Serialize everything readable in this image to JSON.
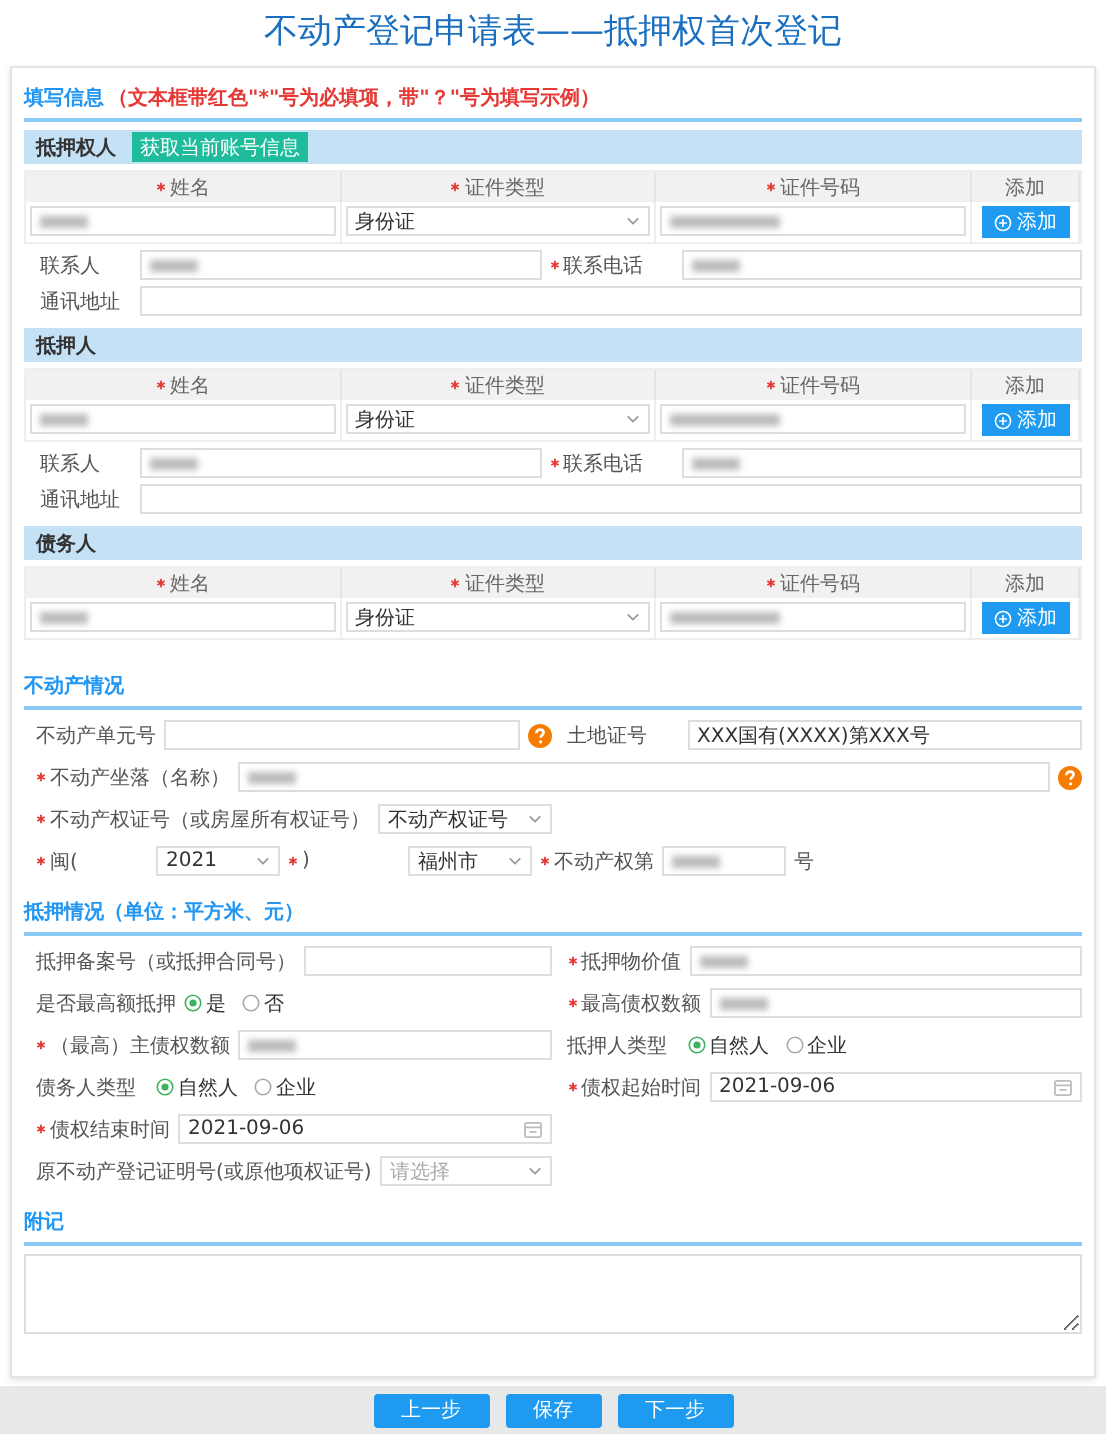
{
  "title": "不动产登记申请表——抵押权首次登记",
  "intro": {
    "title": "填写信息",
    "note": "（文本框带红色\"*\"号为必填项，带\"？\"号为填写示例）"
  },
  "parties": [
    {
      "title": "抵押权人",
      "action_button": "获取当前账号信息",
      "columns": [
        {
          "label": "姓名",
          "required": true
        },
        {
          "label": "证件类型",
          "required": true
        },
        {
          "label": "证件号码",
          "required": true
        },
        {
          "label": "添加",
          "required": false
        }
      ],
      "entry": {
        "name_blurred": true,
        "id_type": "身份证",
        "id_number_blurred": true,
        "add_button": "添加"
      },
      "contact": {
        "label": "联系人",
        "blurred": true
      },
      "phone": {
        "label": "联系电话",
        "required": true,
        "blurred": true
      },
      "address": {
        "label": "通讯地址"
      }
    },
    {
      "title": "抵押人",
      "columns": [
        {
          "label": "姓名",
          "required": true
        },
        {
          "label": "证件类型",
          "required": true
        },
        {
          "label": "证件号码",
          "required": true
        },
        {
          "label": "添加",
          "required": false
        }
      ],
      "entry": {
        "name_blurred": true,
        "id_type": "身份证",
        "id_number_blurred": true,
        "add_button": "添加"
      },
      "contact": {
        "label": "联系人",
        "blurred": true
      },
      "phone": {
        "label": "联系电话",
        "required": true,
        "blurred": true
      },
      "address": {
        "label": "通讯地址"
      }
    },
    {
      "title": "债务人",
      "columns": [
        {
          "label": "姓名",
          "required": true
        },
        {
          "label": "证件类型",
          "required": true
        },
        {
          "label": "证件号码",
          "required": true
        },
        {
          "label": "添加",
          "required": false
        }
      ],
      "entry": {
        "name_blurred": true,
        "id_type": "身份证",
        "id_number_blurred": true,
        "add_button": "添加"
      }
    }
  ],
  "sections": [
    {
      "title": "不动产情况",
      "fields": [
        {
          "kind": "input",
          "label": "不动产单元号",
          "required": false,
          "help": true
        },
        {
          "kind": "input",
          "label": "土地证号",
          "required": false,
          "value": "XXX国有(XXXX)第XXX号"
        },
        {
          "kind": "input",
          "label": "不动产坐落（名称）",
          "required": true,
          "blurred": true,
          "help": true,
          "wide": true
        },
        {
          "kind": "select",
          "label": "不动产权证号（或房屋所有权证号）",
          "required": true,
          "value": "不动产权证号"
        },
        {
          "kind": "cert_number",
          "wide": true,
          "parts": [
            {
              "kind": "select",
              "label": "闽(",
              "required": true,
              "value": "2021"
            },
            {
              "kind": "select",
              "label": ")",
              "required": true,
              "value": "福州市"
            },
            {
              "kind": "input",
              "label": "不动产权第",
              "required": true,
              "blurred": true
            },
            {
              "kind": "text",
              "label": "号"
            }
          ]
        }
      ]
    },
    {
      "title": "抵押情况（单位：平方米、元）",
      "fields": [
        {
          "kind": "input",
          "label": "抵押备案号（或抵押合同号）",
          "required": false
        },
        {
          "kind": "input",
          "label": "抵押物价值",
          "required": true,
          "blurred": true
        },
        {
          "kind": "radio",
          "label": "是否最高额抵押",
          "required": false,
          "options": [
            {
              "label": "是",
              "selected": true
            },
            {
              "label": "否",
              "selected": false
            }
          ]
        },
        {
          "kind": "input",
          "label": "最高债权数额",
          "required": true,
          "blurred": true
        },
        {
          "kind": "input",
          "label": "（最高）主债权数额",
          "required": true,
          "blurred": true
        },
        {
          "kind": "radio",
          "label": "抵押人类型",
          "required": false,
          "options": [
            {
              "label": "自然人",
              "selected": true
            },
            {
              "label": "企业",
              "selected": false
            }
          ]
        },
        {
          "kind": "radio",
          "label": "债务人类型",
          "required": false,
          "options": [
            {
              "label": "自然人",
              "selected": true
            },
            {
              "label": "企业",
              "selected": false
            }
          ]
        },
        {
          "kind": "date",
          "label": "债权起始时间",
          "required": true,
          "value": "2021-09-06"
        },
        {
          "kind": "date",
          "label": "债权结束时间",
          "required": true,
          "value": "2021-09-06"
        },
        {
          "kind": "empty"
        },
        {
          "kind": "select",
          "label": "原不动产登记证明号(或原他项权证号)",
          "required": false,
          "placeholder": "请选择"
        }
      ]
    }
  ],
  "remarks": {
    "title": "附记"
  },
  "buttons": [
    "上一步",
    "保存",
    "下一步"
  ]
}
